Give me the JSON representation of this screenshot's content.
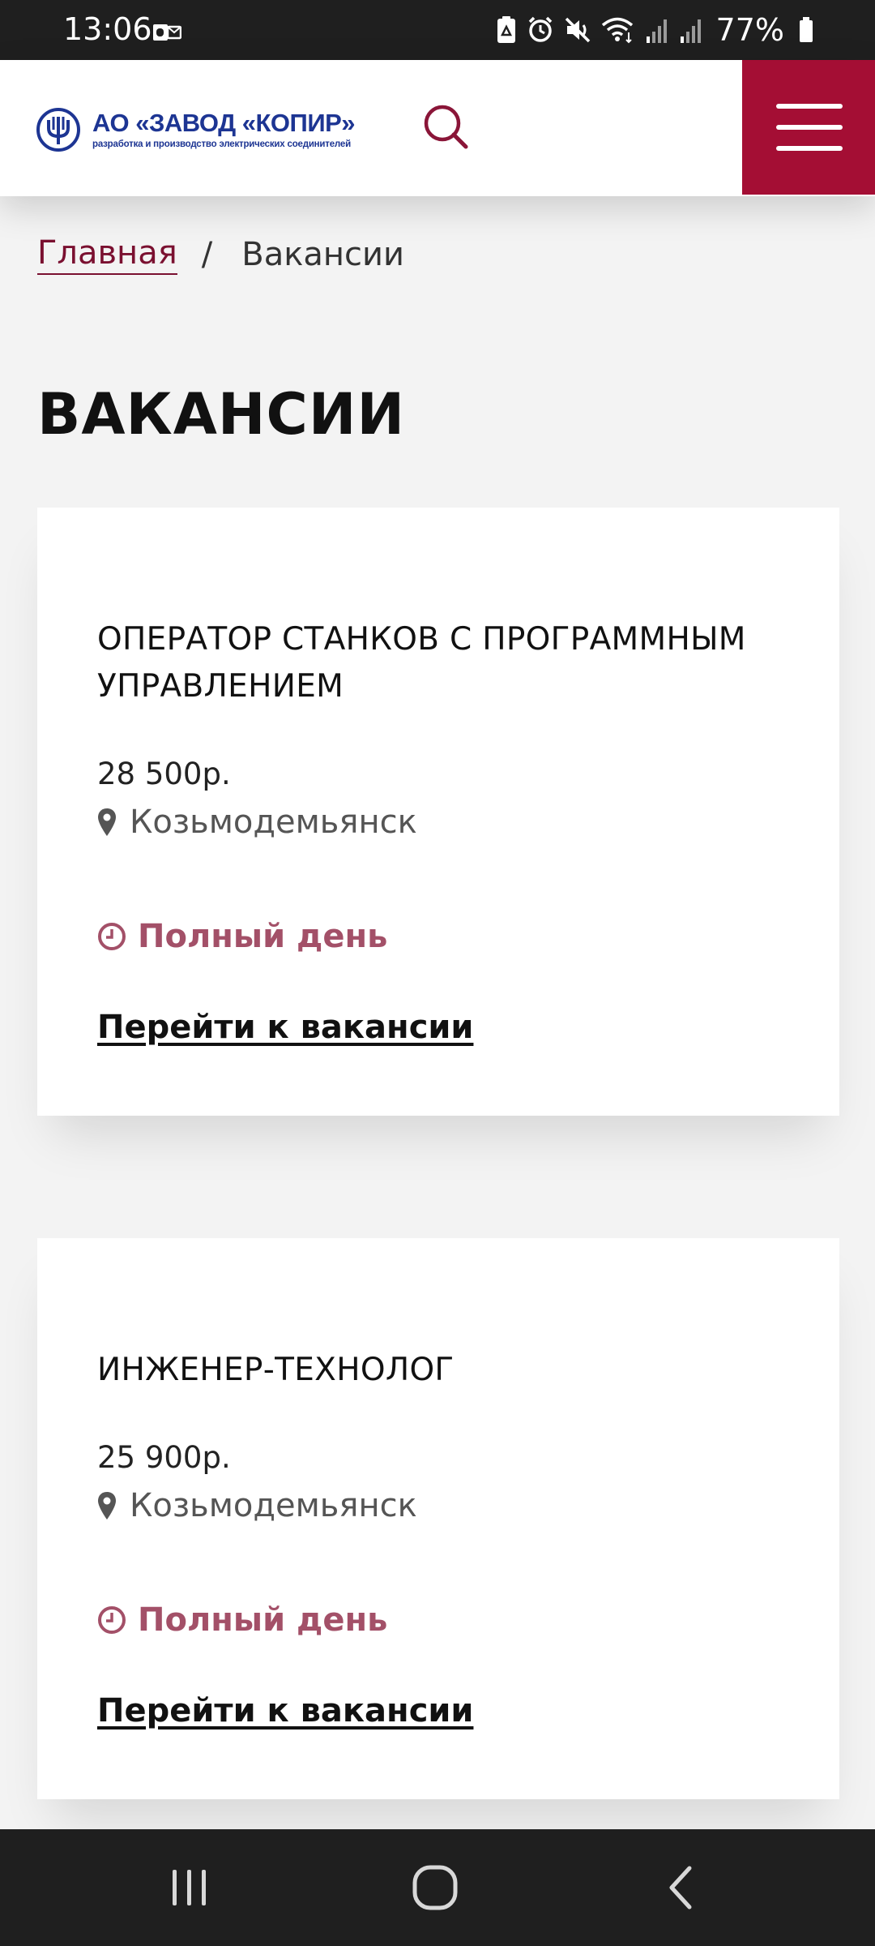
{
  "status_bar": {
    "time": "13:06",
    "battery_percent": "77%",
    "icons": [
      "outlook-notification-icon",
      "recycle-icon",
      "alarm-icon",
      "mute-icon",
      "wifi-icon",
      "signal-icon",
      "signal-icon",
      "battery-icon"
    ]
  },
  "header": {
    "logo_title": "АО «ЗАВОД «КОПИР»",
    "logo_subtitle": "разработка и производство электрических соединителей",
    "search_icon": "search-icon",
    "menu_icon": "hamburger-menu-icon"
  },
  "breadcrumb": {
    "home": "Главная",
    "separator": "/",
    "current": "Вакансии"
  },
  "page": {
    "title": "ВАКАНСИИ"
  },
  "vacancies": [
    {
      "title": "ОПЕРАТОР СТАНКОВ С ПРОГРАММНЫМ УПРАВЛЕНИЕМ",
      "salary": "28 500р.",
      "location": "Козьмодемьянск",
      "schedule": "Полный день",
      "link": "Перейти к вакансии"
    },
    {
      "title": "ИНЖЕНЕР-ТЕХНОЛОГ",
      "salary": "25 900р.",
      "location": "Козьмодемьянск",
      "schedule": "Полный день",
      "link": "Перейти к вакансии"
    }
  ],
  "colors": {
    "accent": "#a40e34",
    "breadcrumb_link": "#7a1030",
    "schedule": "#a35068",
    "logo_blue": "#1d3593",
    "background": "#f3f3f3"
  },
  "nav_bar": {
    "buttons": [
      "recent-apps-icon",
      "home-icon",
      "back-icon"
    ]
  }
}
